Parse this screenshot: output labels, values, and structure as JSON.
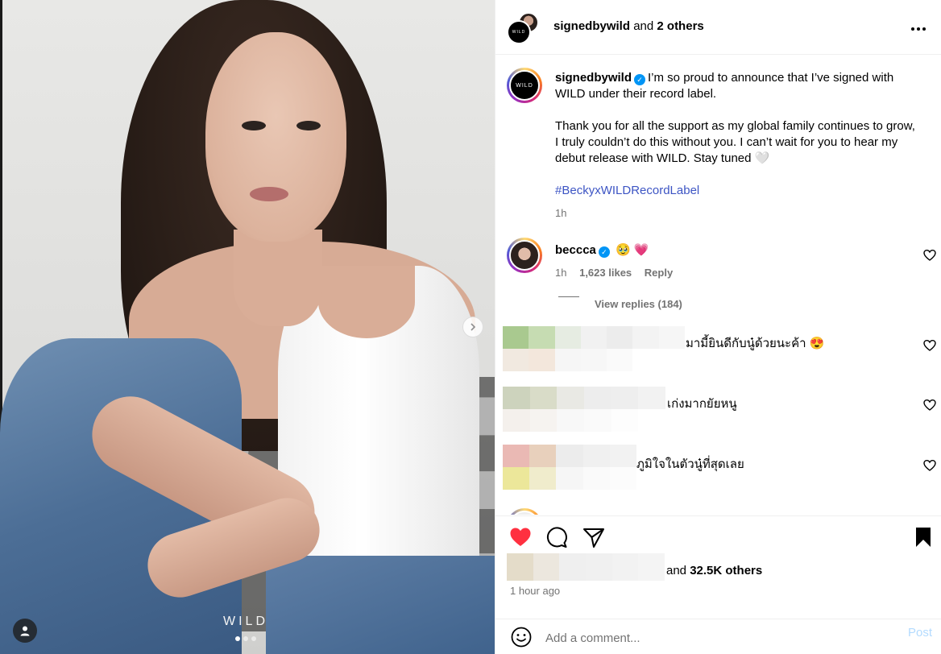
{
  "post_media": {
    "watermark": "WILD",
    "big_letters": [
      "B",
      "E"
    ],
    "carousel": {
      "total": 3,
      "active": 1
    }
  },
  "header": {
    "username": "signedbywild",
    "collab_suffix": "and",
    "others": "2 others",
    "more_icon": "more-horizontal-icon"
  },
  "caption": {
    "username": "signedbywild",
    "avatar_text": "WILD",
    "line1": "I’m so proud to announce that I’ve signed with WILD under their record label.",
    "line2": "Thank you for all the support as my global family continues to grow, I truly couldn’t do this without you. I can’t wait for you to hear my debut release with WILD. Stay tuned 🤍",
    "hashtag": "#BeckyxWILDRecordLabel",
    "time": "1h"
  },
  "comments": [
    {
      "username": "beccca",
      "text": "🥹 💗",
      "time": "1h",
      "likes": "1,623 likes",
      "reply_label": "Reply",
      "view_replies": "View replies (184)"
    },
    {
      "text": "มามี้ยินดีกับนู๋ด้วยนะค้า 😍"
    },
    {
      "text": "เก่งมากยัยหนู"
    },
    {
      "text": "ภูมิใจในตัวนู๋ที่สุดเลย"
    }
  ],
  "actions": {
    "likes_suffix": "and",
    "likes_count": "32.5K others",
    "timestamp": "1 hour ago",
    "liked": true,
    "heart_color": "#ff3040"
  },
  "comment_box": {
    "placeholder": "Add a comment...",
    "post_label": "Post",
    "post_color": "#b3dbff"
  }
}
